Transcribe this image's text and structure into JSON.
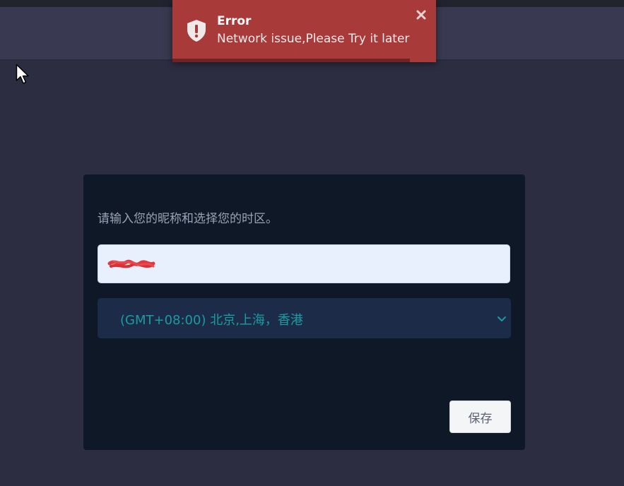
{
  "toast": {
    "title": "Error",
    "message": "Network issue,Please Try it later",
    "icon": "shield-exclamation-icon",
    "close_icon": "close-icon",
    "color": "#a93a3a",
    "progress": 0.9
  },
  "form": {
    "prompt": "请输入您的昵称和选择您的时区。",
    "nickname": {
      "value_redacted": true
    },
    "timezone": {
      "selected": "(GMT+08:00) 北京,上海，香港",
      "icon": "chevron-down-icon"
    },
    "save_label": "保存"
  },
  "colors": {
    "background": "#2d2d41",
    "header": "#393a51",
    "card": "#0f1827",
    "select_bg": "#1c2c48",
    "select_text": "#1b9ba1",
    "error": "#a93a3a"
  }
}
